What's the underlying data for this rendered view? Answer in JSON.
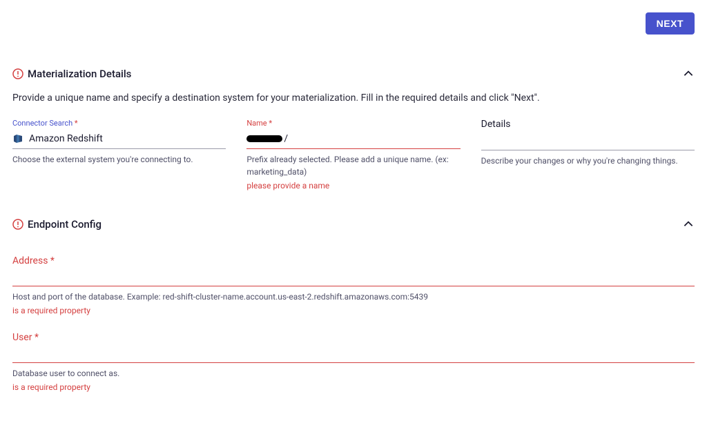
{
  "header": {
    "next_label": "NEXT"
  },
  "materialization": {
    "title": "Materialization Details",
    "description": "Provide a unique name and specify a destination system for your materialization. Fill in the required details and click \"Next\".",
    "connector": {
      "label": "Connector Search",
      "value": "Amazon Redshift",
      "helper": "Choose the external system you're connecting to."
    },
    "name": {
      "label": "Name",
      "slash": "/",
      "helper": "Prefix already selected. Please add a unique name. (ex: marketing_data)",
      "error": "please provide a name"
    },
    "details": {
      "label": "Details",
      "helper": "Describe your changes or why you're changing things."
    }
  },
  "endpoint": {
    "title": "Endpoint Config",
    "address": {
      "label": "Address",
      "helper": "Host and port of the database. Example: red-shift-cluster-name.account.us-east-2.redshift.amazonaws.com:5439",
      "error": "is a required property"
    },
    "user": {
      "label": "User",
      "helper": "Database user to connect as.",
      "error": "is a required property"
    }
  }
}
